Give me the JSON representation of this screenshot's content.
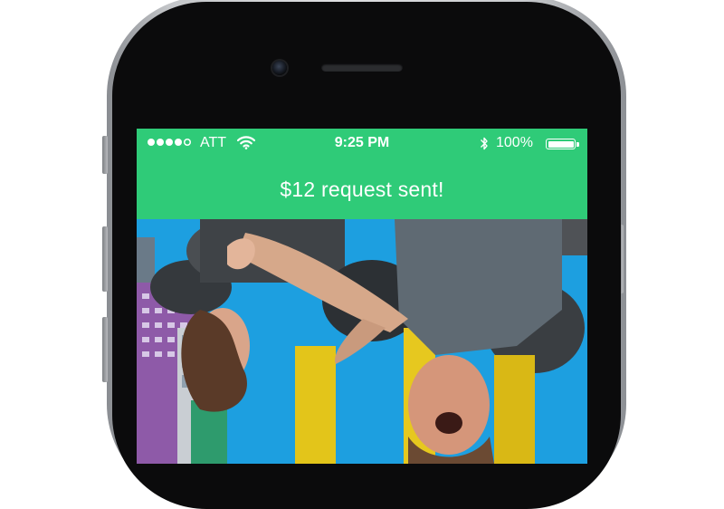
{
  "statusbar": {
    "carrier": "ATT",
    "time": "9:25 PM",
    "battery_percent": "100%",
    "signal_icon": "signal-dots-icon",
    "wifi_icon": "wifi-icon",
    "bluetooth_icon": "bluetooth-icon",
    "battery_icon": "battery-full-icon",
    "signal_bars_filled": 4,
    "signal_bars_total": 5
  },
  "banner": {
    "message": "$12 request sent!"
  },
  "photo": {
    "description_icon": "photo-image"
  },
  "colors": {
    "accent": "#2fcb78",
    "text_on_accent": "#ffffff",
    "phone_bezel": "#0b0b0c",
    "phone_frame": "#c4c6c9"
  }
}
